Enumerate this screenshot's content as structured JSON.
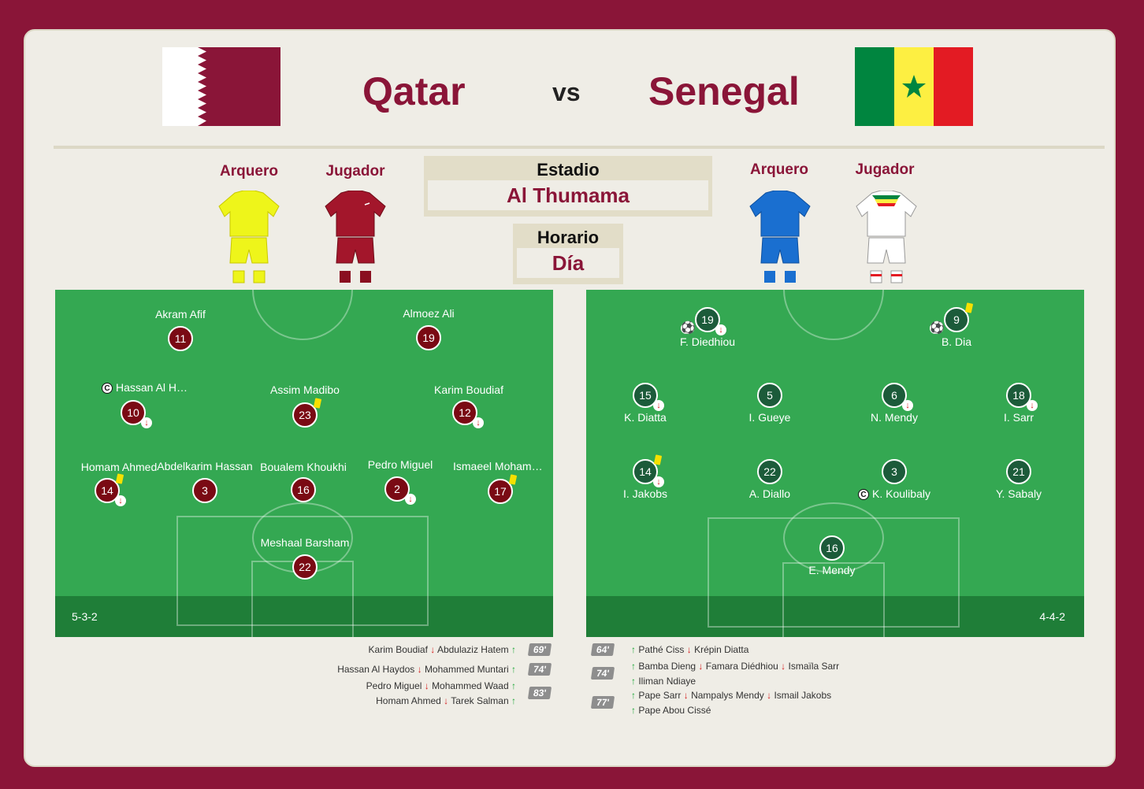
{
  "header": {
    "home_team": "Qatar",
    "vs": "vs",
    "away_team": "Senegal",
    "home_flag": "qatar-flag",
    "away_flag": "senegal-flag"
  },
  "kits": {
    "home_goalkeeper_label": "Arquero",
    "home_player_label": "Jugador",
    "away_goalkeeper_label": "Arquero",
    "away_player_label": "Jugador"
  },
  "venue": {
    "stadium_title": "Estadio",
    "stadium_value": "Al Thumama",
    "time_title": "Horario",
    "time_value": "Día"
  },
  "colors": {
    "brand": "#8a1538",
    "pitch": "#34a852",
    "pitch_band": "#1f7e38",
    "home_player": "#7a0a14",
    "away_player": "#1c5b3a",
    "sub_in": "#1fa83a",
    "sub_out": "#d62020",
    "yellow_card": "#f6e000"
  },
  "home_lineup": {
    "formation": "5-3-2",
    "players": [
      {
        "name": "Akram Afif",
        "number": "11"
      },
      {
        "name": "Almoez Ali",
        "number": "19"
      },
      {
        "name": "Hassan Al Haydos",
        "number": "10",
        "captain": true,
        "subbed_off": true
      },
      {
        "name": "Assim Madibo",
        "number": "23",
        "yellow_card": true
      },
      {
        "name": "Karim Boudiaf",
        "number": "12",
        "subbed_off": true
      },
      {
        "name": "Homam Ahmed",
        "number": "14",
        "yellow_card": true,
        "subbed_off": true
      },
      {
        "name": "Abdelkarim Hassan",
        "number": "3"
      },
      {
        "name": "Boualem Khoukhi",
        "number": "16"
      },
      {
        "name": "Pedro Miguel",
        "number": "2",
        "subbed_off": true
      },
      {
        "name": "Ismaeel Mohammad",
        "number": "17",
        "yellow_card": true
      },
      {
        "name": "Meshaal Barsham",
        "number": "22"
      }
    ]
  },
  "away_lineup": {
    "formation": "4-4-2",
    "players": [
      {
        "name": "F. Diedhiou",
        "number": "19",
        "goal": true,
        "subbed_off": true
      },
      {
        "name": "B. Dia",
        "number": "9",
        "goal": true,
        "yellow_card": true
      },
      {
        "name": "K. Diatta",
        "number": "15",
        "subbed_off": true
      },
      {
        "name": "I. Gueye",
        "number": "5"
      },
      {
        "name": "N. Mendy",
        "number": "6",
        "subbed_off": true
      },
      {
        "name": "I. Sarr",
        "number": "18",
        "subbed_off": true
      },
      {
        "name": "I. Jakobs",
        "number": "14",
        "yellow_card": true,
        "subbed_off": true
      },
      {
        "name": "A. Diallo",
        "number": "22"
      },
      {
        "name": "K. Koulibaly",
        "number": "3",
        "captain": true
      },
      {
        "name": "Y. Sabaly",
        "number": "21"
      },
      {
        "name": "E. Mendy",
        "number": "16"
      }
    ]
  },
  "home_subs": {
    "rows": [
      {
        "out": "Karim Boudiaf",
        "in": "Abdulaziz Hatem"
      },
      {
        "out": "Hassan Al Haydos",
        "in": "Mohammed Muntari"
      },
      {
        "out": "Pedro Miguel",
        "in": "Mohammed Waad"
      },
      {
        "out": "Homam Ahmed",
        "in": "Tarek Salman"
      }
    ],
    "minutes": [
      "69'",
      "74'",
      "83'"
    ]
  },
  "away_subs": {
    "minutes": [
      "64'",
      "74'",
      "77'"
    ],
    "lines": [
      {
        "in": "Pathé Ciss",
        "out": "Krépin Diatta"
      },
      {
        "in": "Bamba Dieng",
        "out": "Famara Diédhiou",
        "out2": "Ismaïla Sarr"
      },
      {
        "in": "Iliman Ndiaye"
      },
      {
        "in": "Pape Sarr",
        "out": "Nampalys Mendy",
        "out2": "Ismail Jakobs"
      },
      {
        "in": "Pape Abou Cissé"
      }
    ]
  },
  "symbols": {
    "captain": "C",
    "arrow_in": "↑",
    "arrow_out": "↓",
    "ball": "⚽"
  }
}
